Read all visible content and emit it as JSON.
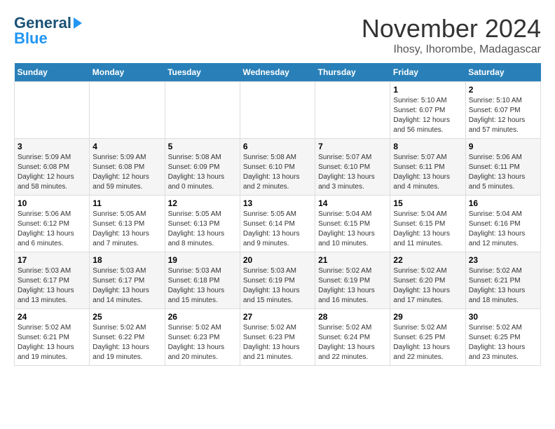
{
  "header": {
    "logo_general": "General",
    "logo_blue": "Blue",
    "month_title": "November 2024",
    "location": "Ihosy, Ihorombe, Madagascar"
  },
  "weekdays": [
    "Sunday",
    "Monday",
    "Tuesday",
    "Wednesday",
    "Thursday",
    "Friday",
    "Saturday"
  ],
  "weeks": [
    [
      {
        "day": "",
        "info": ""
      },
      {
        "day": "",
        "info": ""
      },
      {
        "day": "",
        "info": ""
      },
      {
        "day": "",
        "info": ""
      },
      {
        "day": "",
        "info": ""
      },
      {
        "day": "1",
        "info": "Sunrise: 5:10 AM\nSunset: 6:07 PM\nDaylight: 12 hours and 56 minutes."
      },
      {
        "day": "2",
        "info": "Sunrise: 5:10 AM\nSunset: 6:07 PM\nDaylight: 12 hours and 57 minutes."
      }
    ],
    [
      {
        "day": "3",
        "info": "Sunrise: 5:09 AM\nSunset: 6:08 PM\nDaylight: 12 hours and 58 minutes."
      },
      {
        "day": "4",
        "info": "Sunrise: 5:09 AM\nSunset: 6:08 PM\nDaylight: 12 hours and 59 minutes."
      },
      {
        "day": "5",
        "info": "Sunrise: 5:08 AM\nSunset: 6:09 PM\nDaylight: 13 hours and 0 minutes."
      },
      {
        "day": "6",
        "info": "Sunrise: 5:08 AM\nSunset: 6:10 PM\nDaylight: 13 hours and 2 minutes."
      },
      {
        "day": "7",
        "info": "Sunrise: 5:07 AM\nSunset: 6:10 PM\nDaylight: 13 hours and 3 minutes."
      },
      {
        "day": "8",
        "info": "Sunrise: 5:07 AM\nSunset: 6:11 PM\nDaylight: 13 hours and 4 minutes."
      },
      {
        "day": "9",
        "info": "Sunrise: 5:06 AM\nSunset: 6:11 PM\nDaylight: 13 hours and 5 minutes."
      }
    ],
    [
      {
        "day": "10",
        "info": "Sunrise: 5:06 AM\nSunset: 6:12 PM\nDaylight: 13 hours and 6 minutes."
      },
      {
        "day": "11",
        "info": "Sunrise: 5:05 AM\nSunset: 6:13 PM\nDaylight: 13 hours and 7 minutes."
      },
      {
        "day": "12",
        "info": "Sunrise: 5:05 AM\nSunset: 6:13 PM\nDaylight: 13 hours and 8 minutes."
      },
      {
        "day": "13",
        "info": "Sunrise: 5:05 AM\nSunset: 6:14 PM\nDaylight: 13 hours and 9 minutes."
      },
      {
        "day": "14",
        "info": "Sunrise: 5:04 AM\nSunset: 6:15 PM\nDaylight: 13 hours and 10 minutes."
      },
      {
        "day": "15",
        "info": "Sunrise: 5:04 AM\nSunset: 6:15 PM\nDaylight: 13 hours and 11 minutes."
      },
      {
        "day": "16",
        "info": "Sunrise: 5:04 AM\nSunset: 6:16 PM\nDaylight: 13 hours and 12 minutes."
      }
    ],
    [
      {
        "day": "17",
        "info": "Sunrise: 5:03 AM\nSunset: 6:17 PM\nDaylight: 13 hours and 13 minutes."
      },
      {
        "day": "18",
        "info": "Sunrise: 5:03 AM\nSunset: 6:17 PM\nDaylight: 13 hours and 14 minutes."
      },
      {
        "day": "19",
        "info": "Sunrise: 5:03 AM\nSunset: 6:18 PM\nDaylight: 13 hours and 15 minutes."
      },
      {
        "day": "20",
        "info": "Sunrise: 5:03 AM\nSunset: 6:19 PM\nDaylight: 13 hours and 15 minutes."
      },
      {
        "day": "21",
        "info": "Sunrise: 5:02 AM\nSunset: 6:19 PM\nDaylight: 13 hours and 16 minutes."
      },
      {
        "day": "22",
        "info": "Sunrise: 5:02 AM\nSunset: 6:20 PM\nDaylight: 13 hours and 17 minutes."
      },
      {
        "day": "23",
        "info": "Sunrise: 5:02 AM\nSunset: 6:21 PM\nDaylight: 13 hours and 18 minutes."
      }
    ],
    [
      {
        "day": "24",
        "info": "Sunrise: 5:02 AM\nSunset: 6:21 PM\nDaylight: 13 hours and 19 minutes."
      },
      {
        "day": "25",
        "info": "Sunrise: 5:02 AM\nSunset: 6:22 PM\nDaylight: 13 hours and 19 minutes."
      },
      {
        "day": "26",
        "info": "Sunrise: 5:02 AM\nSunset: 6:23 PM\nDaylight: 13 hours and 20 minutes."
      },
      {
        "day": "27",
        "info": "Sunrise: 5:02 AM\nSunset: 6:23 PM\nDaylight: 13 hours and 21 minutes."
      },
      {
        "day": "28",
        "info": "Sunrise: 5:02 AM\nSunset: 6:24 PM\nDaylight: 13 hours and 22 minutes."
      },
      {
        "day": "29",
        "info": "Sunrise: 5:02 AM\nSunset: 6:25 PM\nDaylight: 13 hours and 22 minutes."
      },
      {
        "day": "30",
        "info": "Sunrise: 5:02 AM\nSunset: 6:25 PM\nDaylight: 13 hours and 23 minutes."
      }
    ]
  ]
}
